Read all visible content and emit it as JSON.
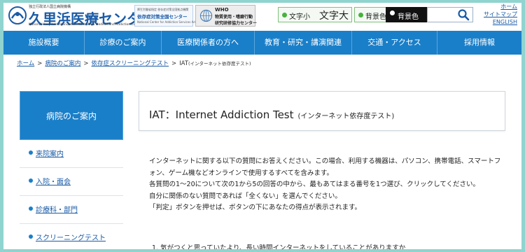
{
  "header": {
    "logo": {
      "small_text": "独立行政法人国立病院機構",
      "name": "久里浜医療センター",
      "english": "National Hospital Organization KURIHAMA Medical and Addiction Center"
    },
    "banner1": {
      "top": "厚生労働省指定 依存症対策全国拠点機関",
      "main": "依存症対策全国センター",
      "sub": "National Center for Addiction Services Administration"
    },
    "banner2": {
      "who": "WHO",
      "line1": "物質使用・嗜癖行動",
      "line2": "研究研修協力センター"
    },
    "font_size": {
      "small": "文字小",
      "large": "文字大"
    },
    "background": {
      "color": "背景色",
      "black": "背景色"
    },
    "links": [
      "ホーム",
      "サイトマップ",
      "ENGLISH"
    ]
  },
  "nav": {
    "items": [
      "施設概要",
      "診療のご案内",
      "医療関係者の方へ",
      "教育・研究・講演関連",
      "交通・アクセス",
      "採用情報"
    ]
  },
  "breadcrumb": {
    "items": [
      "ホーム",
      "病院のご案内",
      "依存症スクリーニングテスト"
    ],
    "current": "IAT",
    "current_note": "(インターネット依存度テスト)"
  },
  "sidebar": {
    "heading": "病院のご案内",
    "items": [
      "来院案内",
      "入院・面会",
      "診療科・部門",
      "スクリーニングテスト"
    ]
  },
  "main": {
    "title": "IAT：Internet Addiction Test",
    "title_sub": "(インターネット依存度テスト)",
    "paragraphs": [
      "インターネットに関する以下の質問にお答えください。この場合、利用する機器は、パソコン、携帯電話、スマートフォン、ゲーム機などオンラインで使用するすべてを含みます。",
      "各質問の1～20について次の1から5の回答の中から、最もあてはまる番号を1つ選び、クリックしてください。",
      "自分に関係のない質問であれば「全くない」を選んでください。",
      "「判定」ボタンを押せば、ボタンの下にあなたの得点が表示されます。"
    ],
    "first_question": "1. 気がつくと思っていたより、長い時間インターネットをしていることがありますか"
  },
  "colors": {
    "brand_blue": "#1a7fc9",
    "link_blue": "#1a5ba6",
    "accent_green": "#46b33c",
    "border_teal": "#8fd4cf"
  }
}
